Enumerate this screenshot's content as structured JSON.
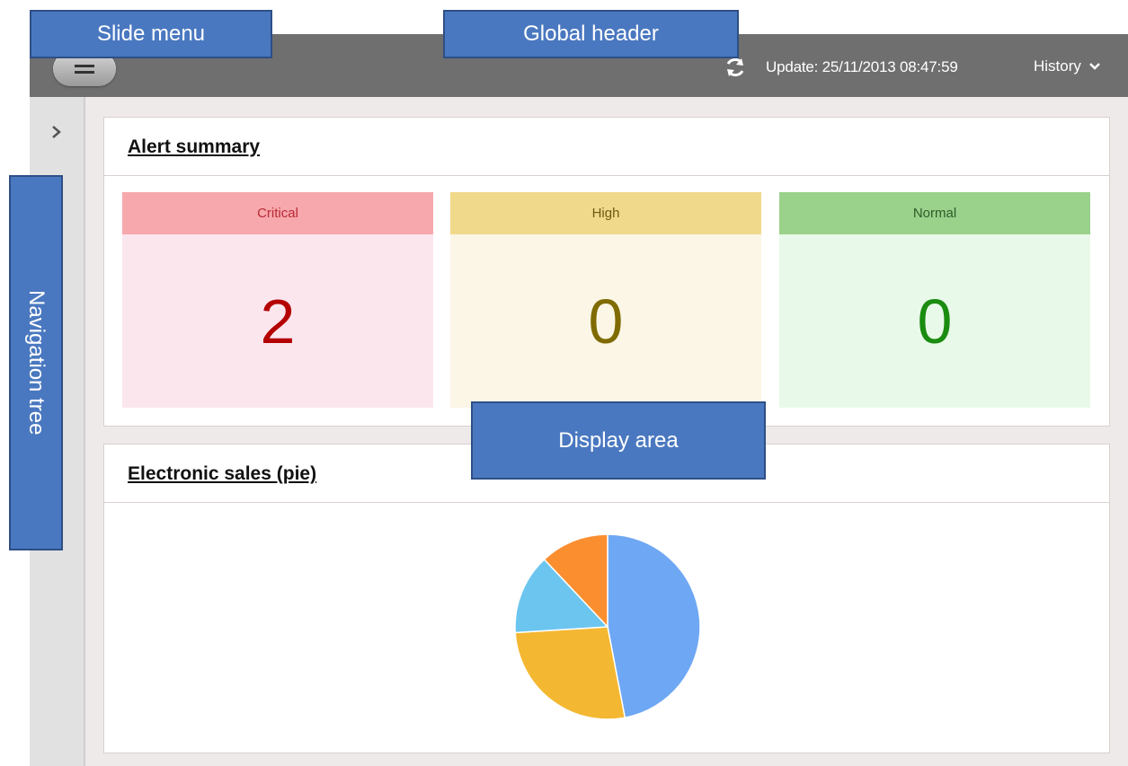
{
  "header": {
    "update_text": "Update: 25/11/2013 08:47:59",
    "history_label": "History",
    "icons": [
      "menu-icon",
      "refresh-icon",
      "chevron-down-icon"
    ]
  },
  "nav_tree": {
    "icons": [
      "chevron-right-icon"
    ]
  },
  "alert_summary": {
    "title": "Alert summary",
    "boxes": [
      {
        "label": "Critical",
        "count": "2"
      },
      {
        "label": "High",
        "count": "0"
      },
      {
        "label": "Normal",
        "count": "0"
      }
    ]
  },
  "sales_panel": {
    "title": "Electronic sales (pie)"
  },
  "callouts": {
    "slide_menu": "Slide menu",
    "global_header": "Global header",
    "navigation_tree": "Navigation tree",
    "display_area": "Display area"
  },
  "colors": {
    "header": "#6f6f6f",
    "callout": "#4a78c0",
    "critical": "#b40000",
    "high": "#7f6b00",
    "normal": "#1a8c10"
  },
  "chart_data": {
    "type": "pie",
    "slices": [
      {
        "value": 0.47,
        "color": "#6ea7f3"
      },
      {
        "value": 0.27,
        "color": "#f4b731"
      },
      {
        "value": 0.14,
        "color": "#6bc5ef"
      },
      {
        "value": 0.12,
        "color": "#fb8e2f"
      }
    ]
  }
}
